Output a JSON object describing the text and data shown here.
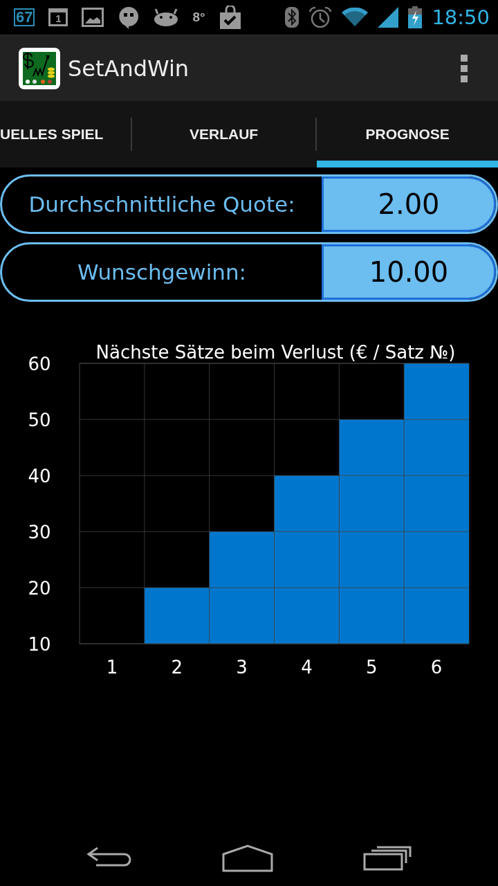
{
  "status_bar": {
    "notification_count": "67",
    "calendar_day": "1",
    "temperature": "8°",
    "time": "18:50"
  },
  "action_bar": {
    "title": "SetAndWin"
  },
  "tabs": [
    {
      "label": "UELLES SPIEL",
      "selected": false
    },
    {
      "label": "VERLAUF",
      "selected": false
    },
    {
      "label": "PROGNOSE",
      "selected": true
    }
  ],
  "fields": [
    {
      "label": "Durchschnittliche Quote:",
      "value": "2.00"
    },
    {
      "label": "Wunschgewinn:",
      "value": "10.00"
    }
  ],
  "chart": {
    "chart_data": {
      "type": "bar",
      "title": "Nächste Sätze beim Verlust (€ / Satz №)",
      "categories": [
        "1",
        "2",
        "3",
        "4",
        "5",
        "6"
      ],
      "values": [
        10,
        20,
        30,
        40,
        50,
        60
      ],
      "ylim": [
        10,
        60
      ],
      "grid": true,
      "yticks": [
        10,
        20,
        30,
        40,
        50,
        60
      ]
    }
  }
}
